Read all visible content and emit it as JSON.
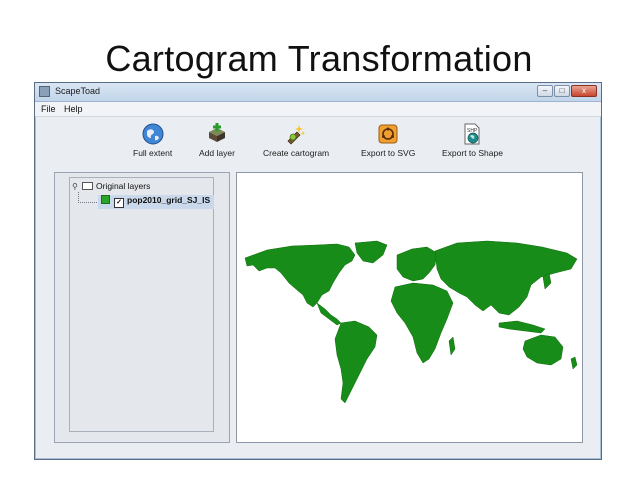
{
  "slide": {
    "title": "Cartogram Transformation"
  },
  "window": {
    "title": "ScapeToad",
    "controls": {
      "minimize": "–",
      "maximize": "□",
      "close": "x"
    }
  },
  "menu": {
    "items": [
      "File",
      "Help"
    ]
  },
  "toolbar": {
    "buttons": [
      {
        "label": "Full extent",
        "icon": "globe-icon"
      },
      {
        "label": "Add layer",
        "icon": "add-layer-icon"
      },
      {
        "label": "Create cartogram",
        "icon": "cartogram-icon"
      },
      {
        "label": "Export to SVG",
        "icon": "svg-export-icon"
      },
      {
        "label": "Export to Shape",
        "icon": "shape-export-icon"
      }
    ]
  },
  "layers": {
    "root_label": "Original layers",
    "items": [
      {
        "name": "pop2010_grid_SJ_IS",
        "checked": true,
        "color": "#2aa52a"
      }
    ]
  },
  "map": {
    "fill_color": "#188c18"
  }
}
